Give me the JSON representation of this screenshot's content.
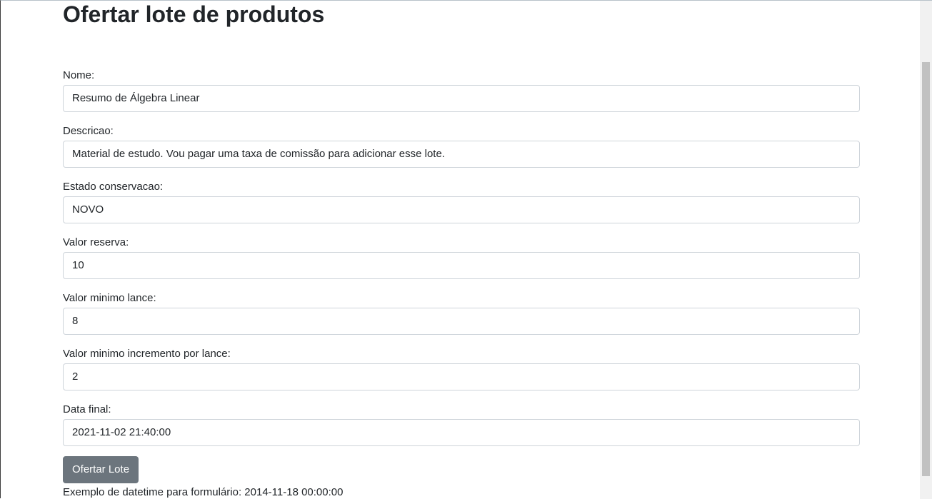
{
  "page": {
    "title": "Ofertar lote de produtos"
  },
  "form": {
    "fields": [
      {
        "label": "Nome:",
        "value": "Resumo de Álgebra Linear"
      },
      {
        "label": "Descricao:",
        "value": "Material de estudo. Vou pagar uma taxa de comissão para adicionar esse lote."
      },
      {
        "label": "Estado conservacao:",
        "value": "NOVO"
      },
      {
        "label": "Valor reserva:",
        "value": "10"
      },
      {
        "label": "Valor minimo lance:",
        "value": "8"
      },
      {
        "label": "Valor minimo incremento por lance:",
        "value": "2"
      },
      {
        "label": "Data final:",
        "value": "2021-11-02 21:40:00"
      }
    ],
    "submit_label": "Ofertar Lote",
    "example_text": "Exemplo de datetime para formulário: 2014-11-18 00:00:00"
  },
  "colors": {
    "button_bg": "#6c757d",
    "input_border": "#ced4da",
    "text": "#212529"
  }
}
